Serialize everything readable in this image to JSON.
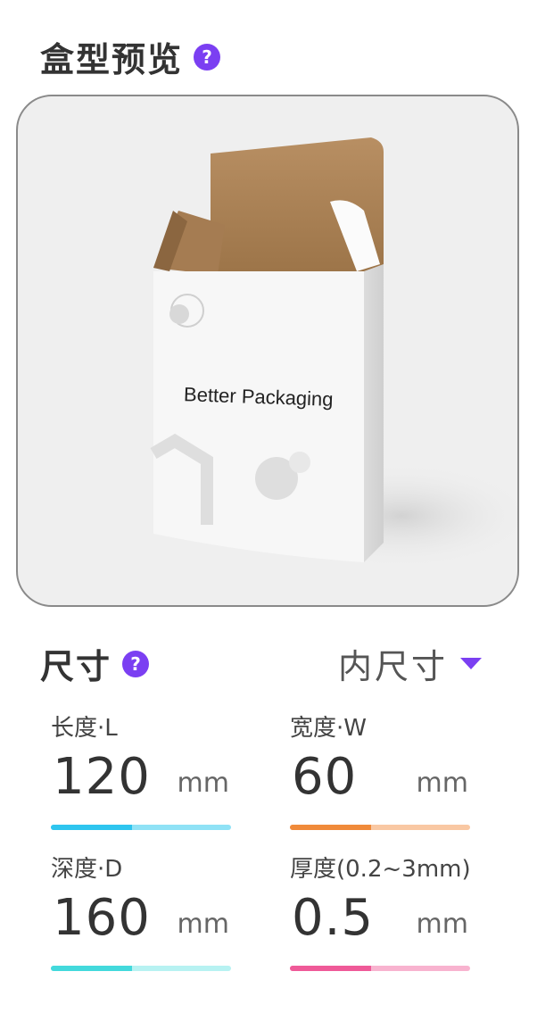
{
  "preview": {
    "title": "盒型预览",
    "help_icon": "?",
    "box_text": "Better Packaging"
  },
  "size": {
    "title": "尺寸",
    "help_icon": "?",
    "mode_label": "内尺寸",
    "dimensions": [
      {
        "label": "长度·L",
        "value": "120",
        "unit": "mm",
        "bar_track_color": "#8fe2f6",
        "bar_fill_color": "#2ec5ef",
        "fill_fraction": 0.45
      },
      {
        "label": "宽度·W",
        "value": "60",
        "unit": "mm",
        "bar_track_color": "#f9c8a3",
        "bar_fill_color": "#f08a3a",
        "fill_fraction": 0.45
      },
      {
        "label": "深度·D",
        "value": "160",
        "unit": "mm",
        "bar_track_color": "#b7f2f2",
        "bar_fill_color": "#43d9dc",
        "fill_fraction": 0.45
      },
      {
        "label": "厚度(0.2~3mm)",
        "value": "0.5",
        "unit": "mm",
        "bar_track_color": "#f8b3cf",
        "bar_fill_color": "#ef5a98",
        "fill_fraction": 0.45
      }
    ]
  },
  "colors": {
    "accent": "#7b3ff2",
    "border": "#8a8a8a"
  }
}
